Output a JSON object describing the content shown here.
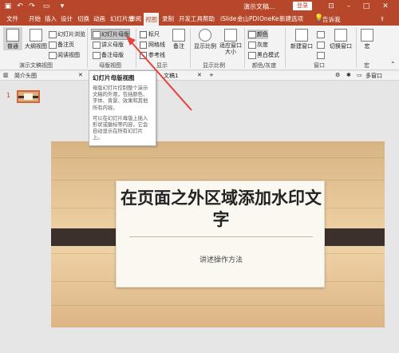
{
  "titlebar": {
    "doc_title": "演示文稿...",
    "login": "登录"
  },
  "tabs": {
    "file": "文件",
    "home": "开始",
    "insert": "插入",
    "design": "设计",
    "transitions": "切换",
    "animations": "动画",
    "slideshow": "幻灯片放",
    "review": "审阅",
    "view": "视图",
    "record": "录制",
    "developer": "开发工具",
    "help": "帮助",
    "islide": "iSlide",
    "onekey": "OneKe",
    "pdf": "金山PDI",
    "newtab": "新建选项",
    "tell_me": "告诉我"
  },
  "ribbon": {
    "normal": "普通",
    "outline": "大纲视图",
    "slide_sorter": "幻灯片浏览",
    "notes_page": "备注页",
    "reading": "阅读视图",
    "group_presentation_views": "演示文稿视图",
    "slide_master": "幻灯片母版",
    "handout_master": "讲义母版",
    "notes_master": "备注母版",
    "group_master_views": "母版视图",
    "ruler": "标尺",
    "gridlines": "网格线",
    "guides": "参考线",
    "group_show": "显示",
    "notes": "备注",
    "zoom": "显示比例",
    "fit": "适应窗口大小",
    "group_zoom": "显示比例",
    "color": "颜色",
    "grayscale": "灰度",
    "bw": "黑白模式",
    "group_color": "颜色/灰度",
    "new_window": "新建窗口",
    "switch_window": "切换窗口",
    "group_window": "窗口",
    "macros_short": "宏",
    "group_macros": "宏"
  },
  "tooltip": {
    "title": "幻灯片母版视图",
    "body": "母版幻灯片控制整个演示文稿的外观，包括颜色、字体、背景、效果和其他所有内容。",
    "body2": "可以在幻灯片母版上插入形状或徽标等内容，它会自动显示在所有幻灯片上。"
  },
  "subbar": {
    "thumb_view": "简介头图",
    "doc_tab": "文稿1",
    "multi_window": "多窗口"
  },
  "slide": {
    "number": "1",
    "title": "在页面之外区域添加水印文字",
    "subtitle": "讲述操作方法"
  },
  "colors": {
    "accent": "#b7472a",
    "ribbon_bg": "#f3f3f3",
    "band": "#3b302c",
    "arrow": "#e8413a"
  },
  "icons": [
    "save-icon",
    "undo-icon",
    "redo-icon",
    "slideshow-icon",
    "lightbulb-icon",
    "share-icon"
  ]
}
